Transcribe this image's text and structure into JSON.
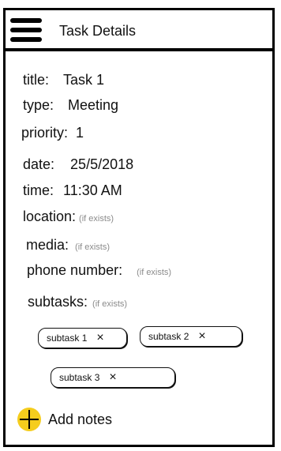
{
  "header": {
    "title": "Task Details",
    "menu_icon": "hamburger-menu-icon"
  },
  "fields": {
    "title": {
      "label": "title:",
      "value": "Task 1"
    },
    "type": {
      "label": "type:",
      "value": "Meeting"
    },
    "priority": {
      "label": "priority:",
      "value": "1"
    },
    "date": {
      "label": "date:",
      "value": "25/5/2018"
    },
    "time": {
      "label": "time:",
      "value": "11:30 AM"
    },
    "location": {
      "label": "location:",
      "hint": "(if exists)"
    },
    "media": {
      "label": "media:",
      "hint": "(if exists)"
    },
    "phone": {
      "label": "phone number:",
      "hint": "(if exists)"
    },
    "subtasks": {
      "label": "subtasks:",
      "hint": "(if exists)"
    }
  },
  "subtask_chips": [
    {
      "label": "subtask 1",
      "close": "×"
    },
    {
      "label": "subtask 2",
      "close": "×"
    },
    {
      "label": "subtask 3",
      "close": "×"
    }
  ],
  "add_notes": {
    "label": "Add notes",
    "icon": "plus-icon",
    "icon_color": "#f5cd1d"
  }
}
